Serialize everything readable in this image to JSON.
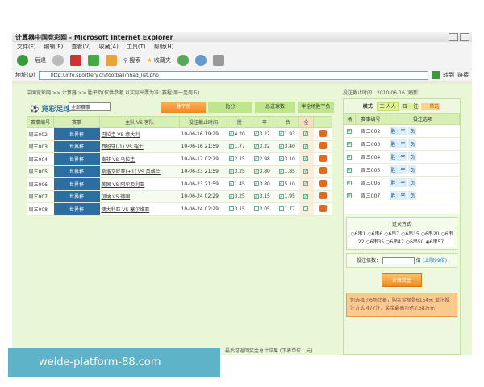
{
  "window": {
    "title": "计算器中国竞彩网 - Microsoft Internet Explorer"
  },
  "menu": [
    "文件(F)",
    "编辑(E)",
    "查看(V)",
    "收藏(A)",
    "工具(T)",
    "帮助(H)"
  ],
  "toolbar": {
    "back": "后退",
    "search": "搜索",
    "favorites": "收藏夹"
  },
  "address": {
    "label": "地址(D)",
    "url": "http://info.sporttery.cn/football/hhad_list.php",
    "go": "转到",
    "links": "链接"
  },
  "page": {
    "breadcrumb": "中国竞彩网 >> 计算器 >> 胜平负(仅供参考,以实际出票为准; 赛程:周一至周五)",
    "deadline": "投注截止时间：2010-06-16 (刷新)",
    "brand": "竞彩足球",
    "select": "全部赛事",
    "tabs": [
      "胜平负",
      "比分",
      "总进球数",
      "半全场胜平负"
    ],
    "columns": [
      "赛事编号",
      "赛事",
      "主队 VS 客队",
      "投注截止时间",
      "胜",
      "平",
      "负",
      "全",
      ""
    ],
    "rows": [
      {
        "id": "周三002",
        "league": "世界杯",
        "teams": "巴拉圭 VS 意大利",
        "time": "10-06-16 19:29",
        "w": "4.20",
        "d": "3.22",
        "l": "1.93",
        "checked": true
      },
      {
        "id": "周三003",
        "league": "世界杯",
        "teams": "西班牙(-1) VS 瑞士",
        "time": "10-06-16 21:59",
        "w": "1.77",
        "d": "3.22",
        "l": "3.40",
        "checked": true
      },
      {
        "id": "周三004",
        "league": "世界杯",
        "teams": "南非 VS 乌拉圭",
        "time": "10-06-17 02:29",
        "w": "2.15",
        "d": "2.98",
        "l": "3.10",
        "checked": true
      },
      {
        "id": "周三005",
        "league": "世界杯",
        "teams": "斯洛文尼亚(+1) VS 英格兰",
        "time": "10-06-23 21:59",
        "w": "3.25",
        "d": "3.80",
        "l": "1.85",
        "checked": true
      },
      {
        "id": "周三006",
        "league": "世界杯",
        "teams": "美国 VS 阿尔及利亚",
        "time": "10-06-23 21:59",
        "w": "1.45",
        "d": "3.80",
        "l": "5.10",
        "checked": true
      },
      {
        "id": "周三007",
        "league": "世界杯",
        "teams": "加纳 VS 德国",
        "time": "10-06-24 02:29",
        "w": "3.25",
        "d": "3.15",
        "l": "1.95",
        "checked": true
      },
      {
        "id": "周三008",
        "league": "世界杯",
        "teams": "澳大利亚 VS 塞尔维亚",
        "time": "10-06-24 02:29",
        "w": "3.15",
        "d": "3.05",
        "l": "1.77",
        "checked": false
      }
    ],
    "footer": "最后可返回奖金总计结果 (下表单位：元)"
  },
  "right": {
    "mode_label": "模式",
    "mode_opts": [
      "三 人人",
      "四 一注",
      "一 单选"
    ],
    "columns": [
      "场",
      "赛事编号",
      "投注选项"
    ],
    "rows": [
      {
        "id": "周三002",
        "opts": [
          "胜",
          "平",
          "负"
        ]
      },
      {
        "id": "周三003",
        "opts": [
          "胜",
          "平",
          "负"
        ]
      },
      {
        "id": "周三004",
        "opts": [
          "胜",
          "平",
          "负"
        ]
      },
      {
        "id": "周三005",
        "opts": [
          "胜",
          "平",
          "负"
        ]
      },
      {
        "id": "周三006",
        "opts": [
          "胜",
          "平",
          "负"
        ]
      },
      {
        "id": "周三007",
        "opts": [
          "胜",
          "平",
          "负"
        ]
      }
    ],
    "pass_title": "过关方式",
    "pass_opts": [
      "6串1",
      "6串6",
      "6串7",
      "6串15",
      "6串20",
      "6串22",
      "6串35",
      "6串42",
      "6串50",
      "6串57"
    ],
    "multiplier_label": "投注倍数：",
    "multiplier_unit": "倍",
    "multiplier_limit": "(上限99倍)",
    "submit": "计算奖金",
    "note": "你选择了6场比赛，购买金额是6154元 单注投注方式 477注，奖金最高可达2.58万元"
  },
  "watermark": "weide-platform-88.com"
}
